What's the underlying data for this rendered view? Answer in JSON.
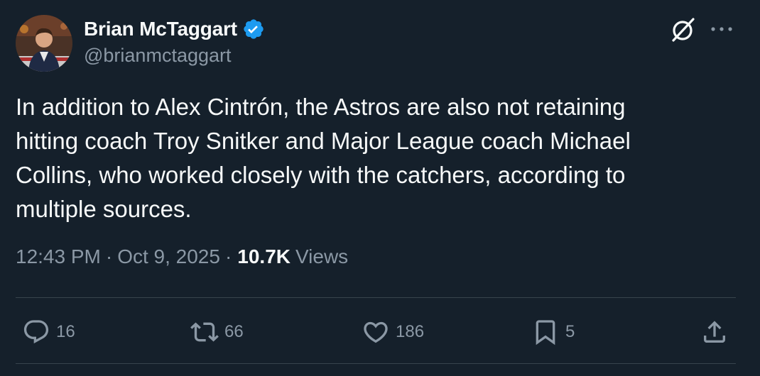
{
  "author": {
    "display_name": "Brian McTaggart",
    "handle": "@brianmctaggart",
    "verified": true,
    "avatar_icon": "user-avatar"
  },
  "tweet": {
    "text": "In addition to Alex Cintrón, the Astros are also not retaining\nhitting coach Troy Snitker and Major League coach Michael\nCollins, who worked closely with the catchers, according to\nmultiple sources.",
    "time": "12:43 PM",
    "date": "Oct 9, 2025",
    "separator": "·",
    "views_count": "10.7K",
    "views_label": "Views"
  },
  "actions": {
    "reply_count": "16",
    "retweet_count": "66",
    "like_count": "186",
    "bookmark_count": "5"
  },
  "colors": {
    "background": "#15202b",
    "text_primary": "#f7f9f9",
    "text_secondary": "#8b98a5",
    "verified_blue": "#1d9bf0",
    "divider": "#38444d"
  }
}
